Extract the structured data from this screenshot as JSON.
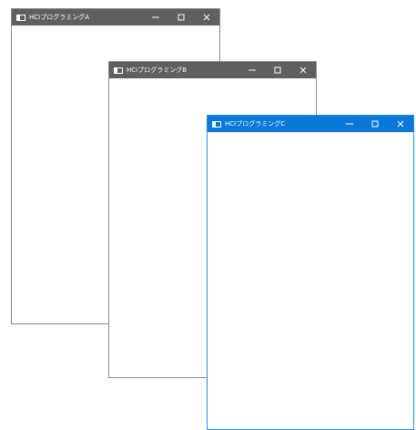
{
  "windows": [
    {
      "id": "a",
      "title": "HCIプログラミングA",
      "state": "inactive",
      "titlebar_color": "#5f5f5f"
    },
    {
      "id": "b",
      "title": "HCIプログラミングB",
      "state": "inactive",
      "titlebar_color": "#5f5f5f"
    },
    {
      "id": "c",
      "title": "HCIプログラミングC",
      "state": "active",
      "titlebar_color": "#0a78d7"
    }
  ],
  "controls": {
    "minimize_icon": "minimize-icon",
    "maximize_icon": "maximize-icon",
    "close_icon": "close-icon"
  }
}
